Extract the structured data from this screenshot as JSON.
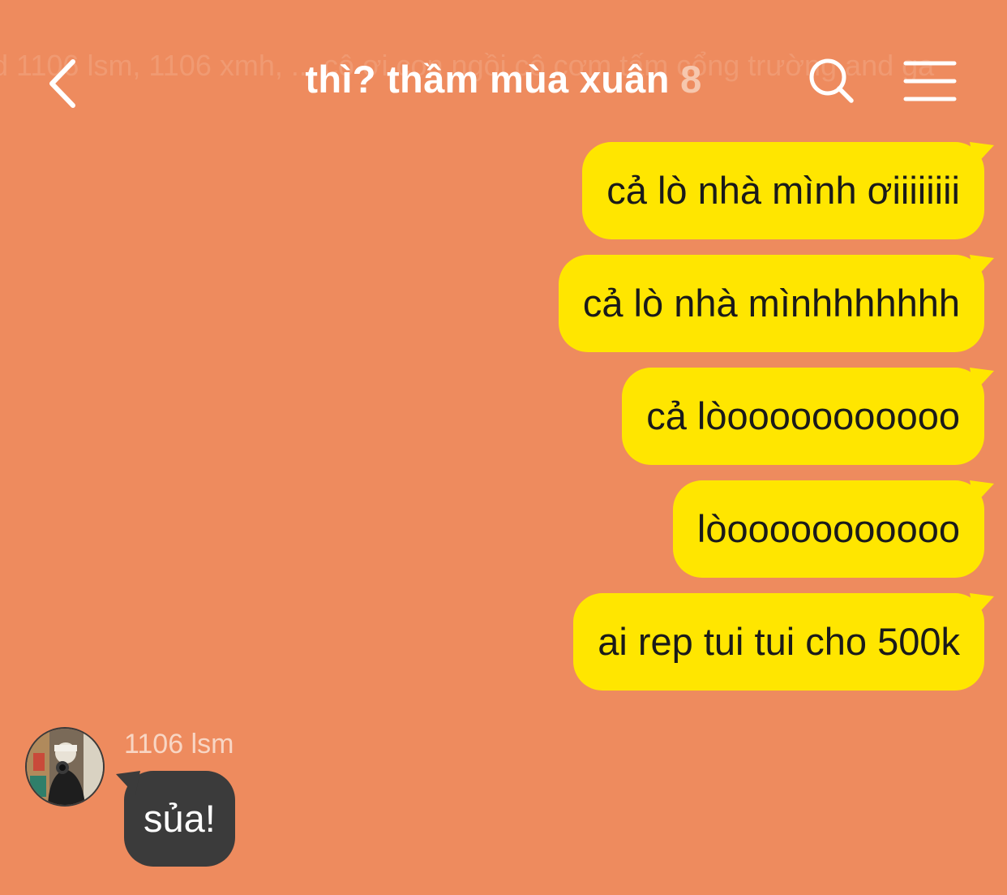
{
  "header": {
    "ghost_text": "d 1106 lsm, 1106 xmh, ... cô ơi con ngồi cô cơm tấm cổng trường and ga",
    "title": "thì? thầm mùa xuân",
    "member_count": "8"
  },
  "messages": {
    "sent": [
      "cả lò nhà mình ơiiiiiiii",
      "cả lò nhà mìnhhhhhhh",
      "cả lòooooooooooo",
      "lòooooooooooo",
      "ai rep tui tui cho 500k"
    ],
    "received": {
      "sender": "1106 lsm",
      "text": "sủa!"
    }
  },
  "colors": {
    "background": "#EE8B5E",
    "sent_bubble": "#FFE600",
    "received_bubble": "#3B3B3B"
  },
  "icons": {
    "back": "chevron-left-icon",
    "search": "search-icon",
    "menu": "hamburger-menu-icon"
  }
}
